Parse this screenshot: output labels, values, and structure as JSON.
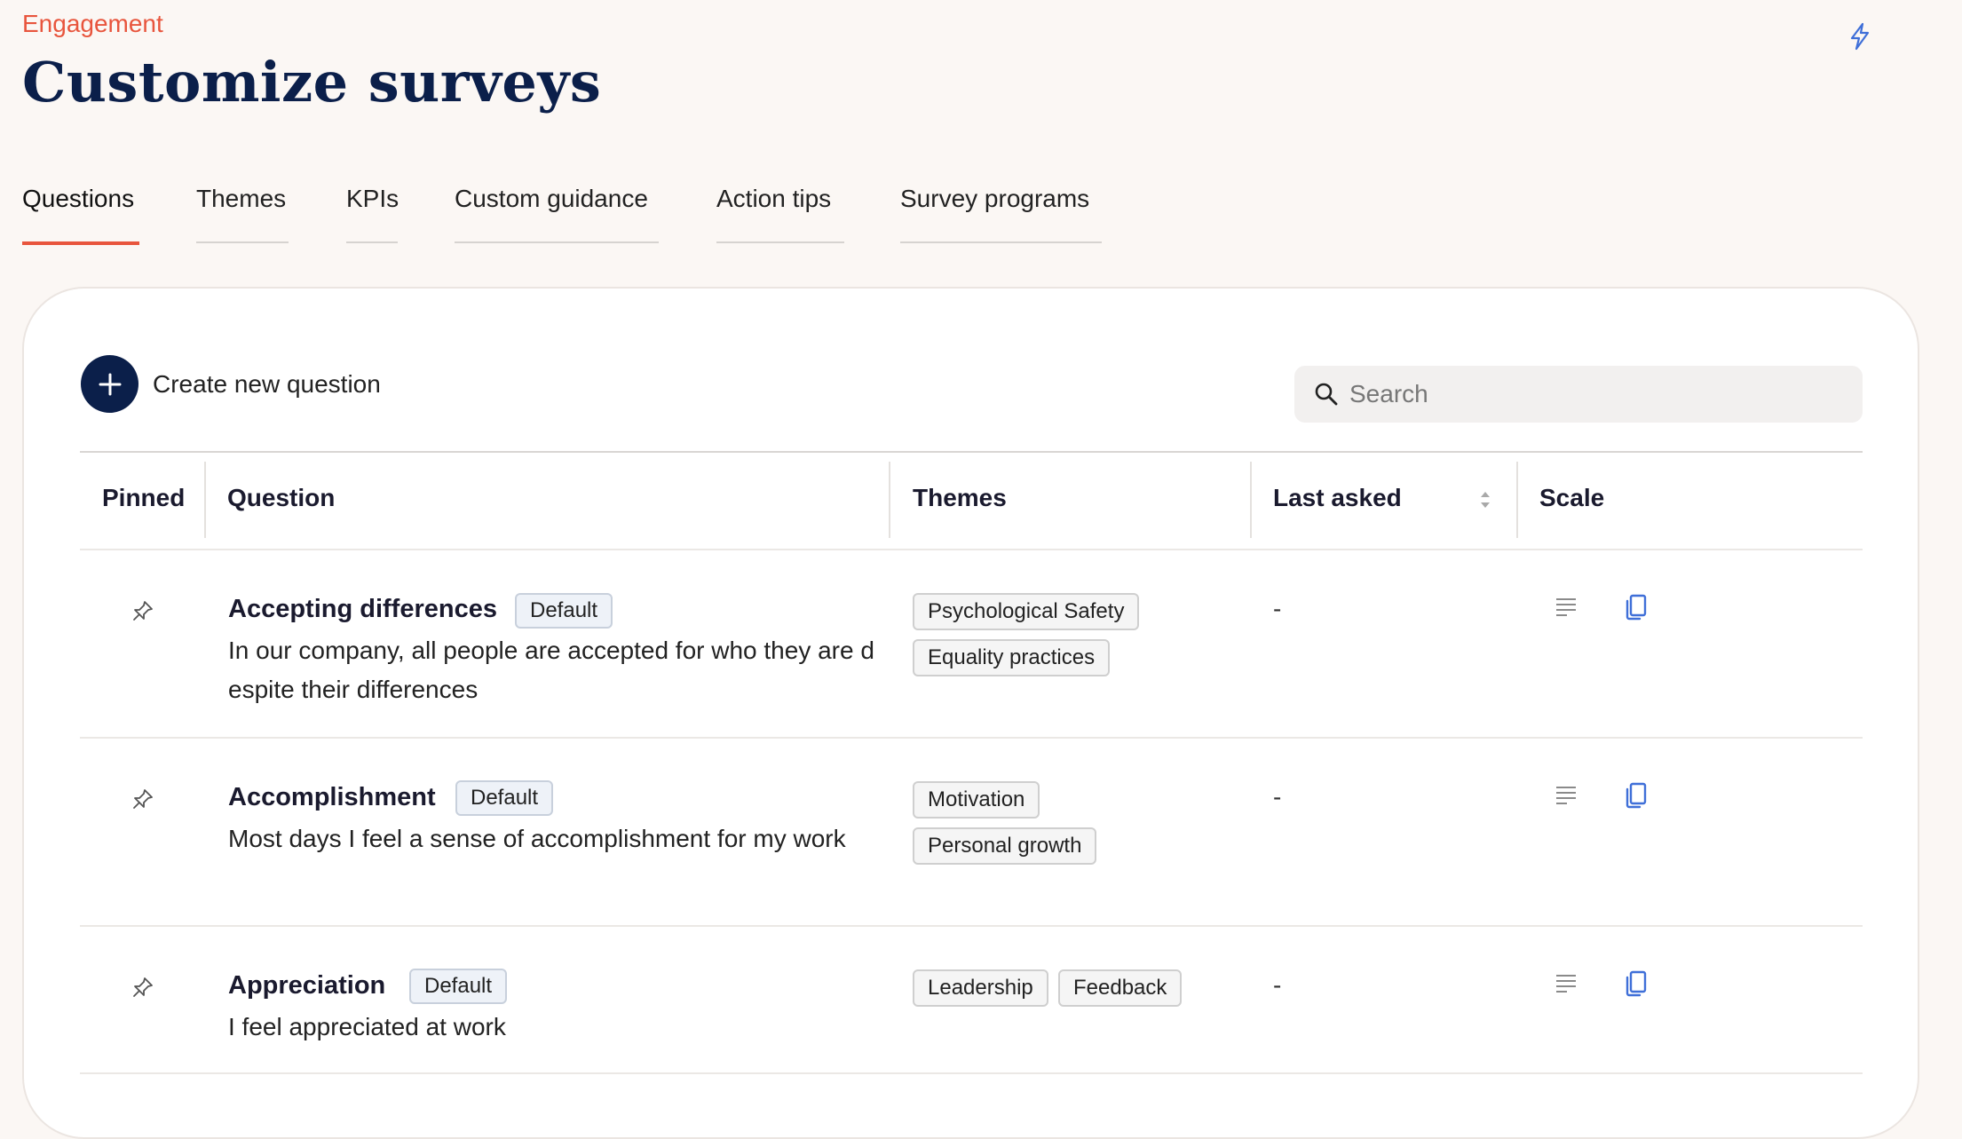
{
  "header": {
    "eyebrow": "Engagement",
    "title": "Customize surveys",
    "bolt_icon": "lightning-bolt-icon"
  },
  "tabs": [
    {
      "label": "Questions",
      "active": true
    },
    {
      "label": "Themes",
      "active": false
    },
    {
      "label": "KPIs",
      "active": false
    },
    {
      "label": "Custom guidance",
      "active": false
    },
    {
      "label": "Action tips",
      "active": false
    },
    {
      "label": "Survey programs",
      "active": false
    }
  ],
  "toolbar": {
    "create_label": "Create new question",
    "search_placeholder": "Search"
  },
  "table": {
    "headers": {
      "pinned": "Pinned",
      "question": "Question",
      "themes": "Themes",
      "last_asked": "Last asked",
      "scale": "Scale"
    },
    "rows": [
      {
        "title": "Accepting differences",
        "badge": "Default",
        "text": "In our company, all people are accepted for who they are despite their differences",
        "themes": [
          "Psychological Safety",
          "Equality practices"
        ],
        "last_asked": "-"
      },
      {
        "title": "Accomplishment",
        "badge": "Default",
        "text": "Most days I feel a sense of accomplishment for my work",
        "themes": [
          "Motivation",
          "Personal growth"
        ],
        "last_asked": "-"
      },
      {
        "title": "Appreciation",
        "badge": "Default",
        "text": "I feel appreciated at work",
        "themes": [
          "Leadership",
          "Feedback"
        ],
        "last_asked": "-"
      }
    ]
  },
  "colors": {
    "accent": "#e8553d",
    "navy": "#0b1f4a",
    "icon_blue": "#3f6fd8",
    "background": "#fbf7f4"
  }
}
